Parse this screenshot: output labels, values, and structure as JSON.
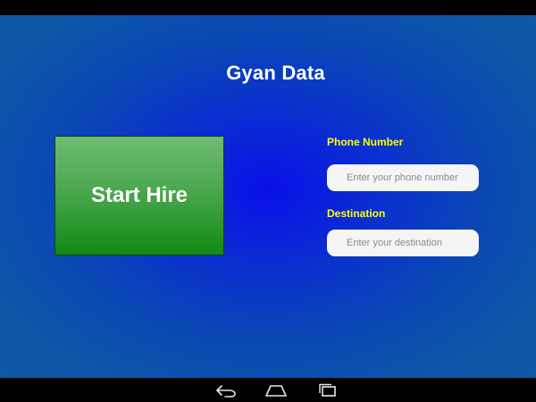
{
  "app": {
    "title": "Gyan Data"
  },
  "main": {
    "start_button_label": "Start Hire",
    "phone": {
      "label": "Phone Number",
      "value": "",
      "placeholder": "Enter your phone number"
    },
    "destination": {
      "label": "Destination",
      "value": "",
      "placeholder": "Enter your destination"
    }
  },
  "navigation_bar": {
    "buttons": [
      {
        "icon": "back-icon"
      },
      {
        "icon": "home-icon"
      },
      {
        "icon": "recents-icon"
      }
    ]
  },
  "colors": {
    "background": "#0a10e8",
    "button_green": "#0f8a14",
    "label_yellow": "#ffff00",
    "field_bg": "#f5f5f5"
  }
}
